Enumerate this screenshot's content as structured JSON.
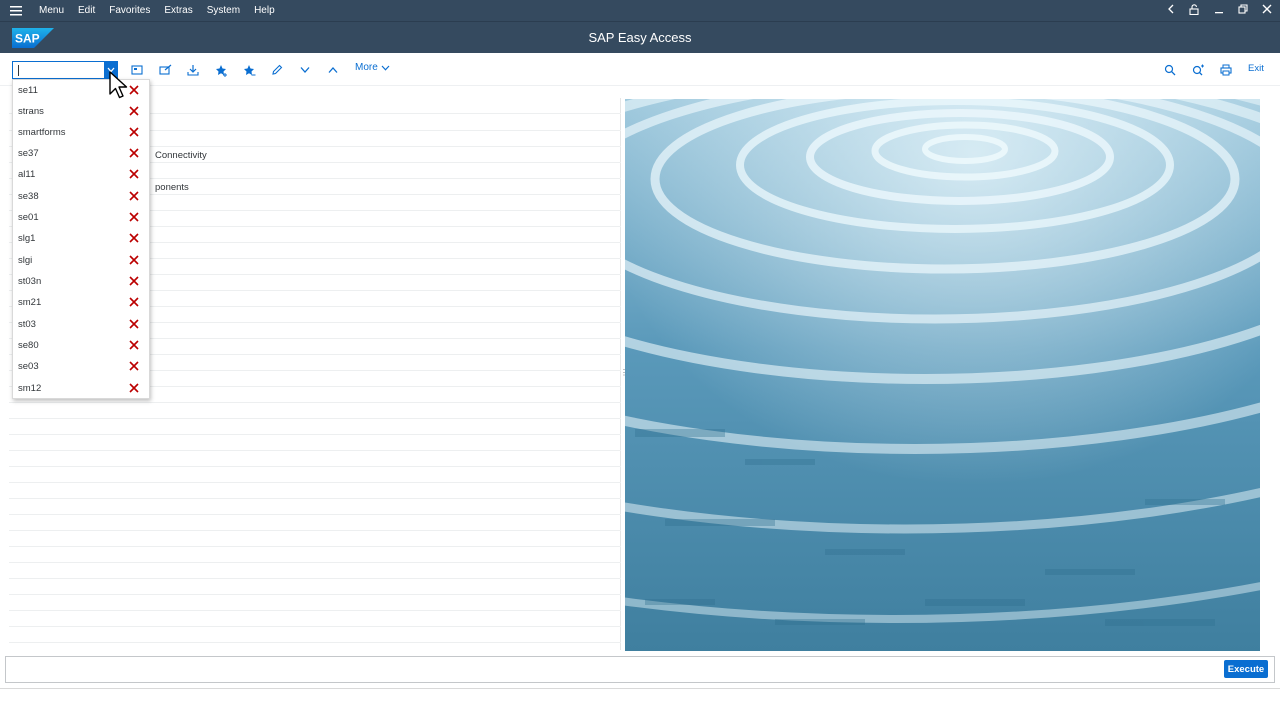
{
  "menubar": {
    "items": [
      "Menu",
      "Edit",
      "Favorites",
      "Extras",
      "System",
      "Help"
    ]
  },
  "app": {
    "logo_text": "SAP",
    "title": "SAP Easy Access"
  },
  "toolbar": {
    "command_value": "",
    "more_label": "More",
    "exit_label": "Exit"
  },
  "tree": {
    "visible_fragments": [
      "Connectivity",
      "ponents"
    ]
  },
  "history_dropdown": {
    "entries": [
      "se11",
      "strans",
      "smartforms",
      "se37",
      "al11",
      "se38",
      "se01",
      "slg1",
      "slgi",
      "st03n",
      "sm21",
      "st03",
      "se80",
      "se03",
      "sm12"
    ]
  },
  "footer": {
    "execute_label": "Execute"
  },
  "colors": {
    "shell": "#354a5f",
    "accent": "#0a6ed1",
    "delete": "#bb0000"
  }
}
